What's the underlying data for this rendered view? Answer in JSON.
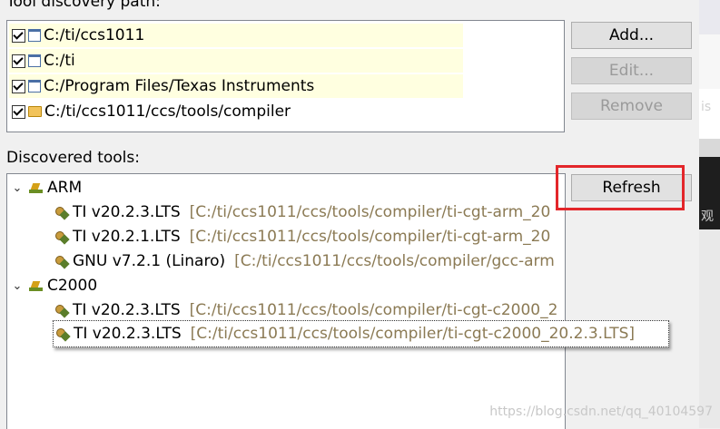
{
  "section_title": "Tool discovery path:",
  "paths": [
    {
      "label": "C:/ti/ccs1011",
      "checked": true,
      "icon": "window-icon",
      "highlighted": true
    },
    {
      "label": "C:/ti",
      "checked": true,
      "icon": "window-icon",
      "highlighted": true
    },
    {
      "label": "C:/Program Files/Texas Instruments",
      "checked": true,
      "icon": "window-icon",
      "highlighted": true
    },
    {
      "label": "C:/ti/ccs1011/ccs/tools/compiler",
      "checked": true,
      "icon": "folder-icon",
      "highlighted": false
    }
  ],
  "buttons": {
    "add": "Add...",
    "edit": "Edit...",
    "remove": "Remove",
    "refresh": "Refresh"
  },
  "discovered_title": "Discovered tools:",
  "tree": [
    {
      "category": "ARM",
      "tools": [
        {
          "name": "TI v20.2.3.LTS",
          "path": "[C:/ti/ccs1011/ccs/tools/compiler/ti-cgt-arm_20"
        },
        {
          "name": "TI v20.2.1.LTS",
          "path": "[C:/ti/ccs1011/ccs/tools/compiler/ti-cgt-arm_20"
        },
        {
          "name": "GNU v7.2.1 (Linaro)",
          "path": "[C:/ti/ccs1011/ccs/tools/compiler/gcc-arm"
        }
      ]
    },
    {
      "category": "C2000",
      "tools": [
        {
          "name": "TI v20.2.3.LTS",
          "path": "[C:/ti/ccs1011/ccs/tools/compiler/ti-cgt-c2000_2"
        }
      ]
    }
  ],
  "selected_tool": {
    "name": "TI v20.2.3.LTS",
    "path": "[C:/ti/ccs1011/ccs/tools/compiler/ti-cgt-c2000_20.2.3.LTS]"
  },
  "right_edge": {
    "glyph_1": "\u0000",
    "glyph_2": "is",
    "glyph_3": "观"
  },
  "watermark": "https://blog.csdn.net/qq_40104597",
  "colors": {
    "highlight_box": "#e3262a",
    "path_row_bg": "#ffffe0",
    "tool_path_text": "#8b7a54"
  }
}
